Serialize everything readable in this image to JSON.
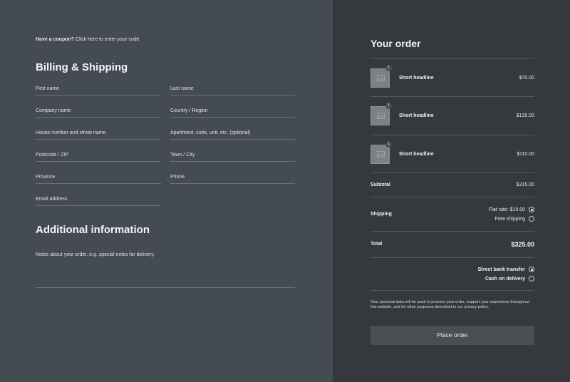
{
  "coupon": {
    "prefix": "Have a coupon?",
    "link": "Click here to enter your code"
  },
  "billing": {
    "title": "Billing & Shipping",
    "fields": {
      "first_name": "First name",
      "last_name": "Last name",
      "company": "Company name",
      "country": "Country / Region",
      "street": "House number and street name",
      "apartment": "Apartment, suite, unit, etc. (optional)",
      "postcode": "Postcode / ZIP",
      "town": "Town / City",
      "province": "Province",
      "phone": "Phone",
      "email": "Email address"
    }
  },
  "additional": {
    "title": "Additional information",
    "notes_placeholder": "Notes about your order, e.g. special notes for delivery."
  },
  "order": {
    "title": "Your order",
    "items": [
      {
        "name": "Short headline",
        "price": "$70.00",
        "qty": "1",
        "icon": "image-icon"
      },
      {
        "name": "Short headline",
        "price": "$135.00",
        "qty": "1",
        "icon": "image-icon"
      },
      {
        "name": "Short headline",
        "price": "$110.00",
        "qty": "1",
        "icon": "image-icon"
      }
    ],
    "subtotal_label": "Subtotal",
    "subtotal_value": "$315.00",
    "shipping_label": "Shipping",
    "shipping_options": [
      {
        "label": "Flat rate: $10.00",
        "checked": true
      },
      {
        "label": "Free shipping",
        "checked": false
      }
    ],
    "total_label": "Total",
    "total_value": "$325.00",
    "payment_options": [
      {
        "label": "Direct bank transfer",
        "checked": true
      },
      {
        "label": "Cash on delivery",
        "checked": false
      }
    ],
    "privacy_text": "Your personal data will be used to process your order, support your experience throughout this website, and for other purposes described in our privacy policy.",
    "place_order": "Place order"
  }
}
